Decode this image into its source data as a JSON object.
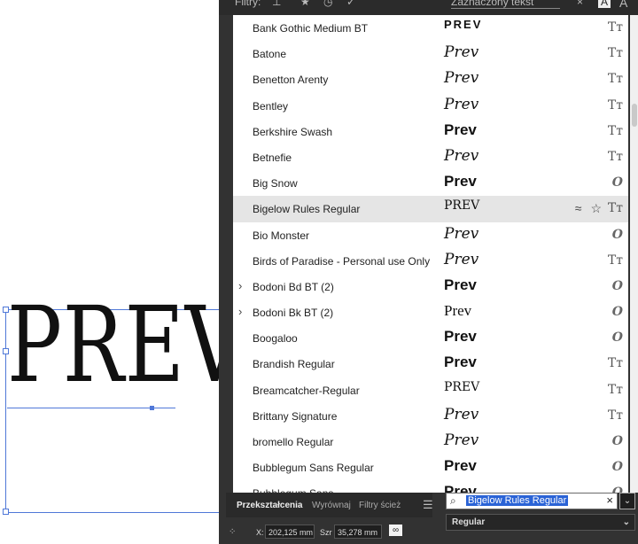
{
  "canvas": {
    "text": "PREV"
  },
  "filters": {
    "label": "Filtry:",
    "selection_dropdown": "Zaznaczony tekst"
  },
  "fonts": [
    {
      "name": "Bank Gothic Medium BT",
      "preview": "PREV",
      "type": "Tт",
      "style": "caps"
    },
    {
      "name": "Batone",
      "preview": "Prev",
      "type": "Tт",
      "style": "script"
    },
    {
      "name": "Benetton Arenty",
      "preview": "Prev",
      "type": "Tт",
      "style": "script"
    },
    {
      "name": "Bentley",
      "preview": "Prev",
      "type": "Tт",
      "style": "script"
    },
    {
      "name": "Berkshire Swash",
      "preview": "Prev",
      "type": "Tт",
      "style": "bold"
    },
    {
      "name": "Betnefie",
      "preview": "Prev",
      "type": "Tт",
      "style": "script"
    },
    {
      "name": "Big Snow",
      "preview": "Prev",
      "type": "O",
      "style": "bold"
    },
    {
      "name": "Bigelow Rules Regular",
      "preview": "PREV",
      "type": "Tт",
      "style": "condensed",
      "selected": true
    },
    {
      "name": "Bio Monster",
      "preview": "Prev",
      "type": "O",
      "style": "script"
    },
    {
      "name": "Birds of Paradise - Personal use Only",
      "preview": "Prev",
      "type": "Tт",
      "style": "script"
    },
    {
      "name": "Bodoni Bd BT (2)",
      "preview": "Prev",
      "type": "O",
      "style": "bold",
      "expand": true
    },
    {
      "name": "Bodoni Bk BT (2)",
      "preview": "Prev",
      "type": "O",
      "style": "serif",
      "expand": true
    },
    {
      "name": "Boogaloo",
      "preview": "Prev",
      "type": "O",
      "style": "bold"
    },
    {
      "name": "Brandish Regular",
      "preview": "Prev",
      "type": "Tт",
      "style": "bold"
    },
    {
      "name": "Breamcatcher-Regular",
      "preview": "PREV",
      "type": "Tт",
      "style": "condensed"
    },
    {
      "name": "Brittany Signature",
      "preview": "Prev",
      "type": "Tт",
      "style": "script"
    },
    {
      "name": "bromello Regular",
      "preview": "Prev",
      "type": "O",
      "style": "script"
    },
    {
      "name": "Bubblegum Sans Regular",
      "preview": "Prev",
      "type": "O",
      "style": "bold"
    },
    {
      "name": "Bubblegum Sans",
      "preview": "Prev",
      "type": "O",
      "style": "bold"
    }
  ],
  "selected_icons": {
    "similar": "≈",
    "favorite": "☆"
  },
  "bottom": {
    "tabs": [
      "Przekształcenia",
      "Wyrównaj",
      "Filtry ścież"
    ],
    "x_label": "X:",
    "x_value": "202,125 mm",
    "w_label": "Szr",
    "w_value": "35,278 mm",
    "search_value": "Bigelow Rules Regular",
    "style_value": "Regular"
  },
  "colors": {
    "panel": "#323232",
    "selection": "#2a63d6",
    "frame": "#4f78d8"
  }
}
